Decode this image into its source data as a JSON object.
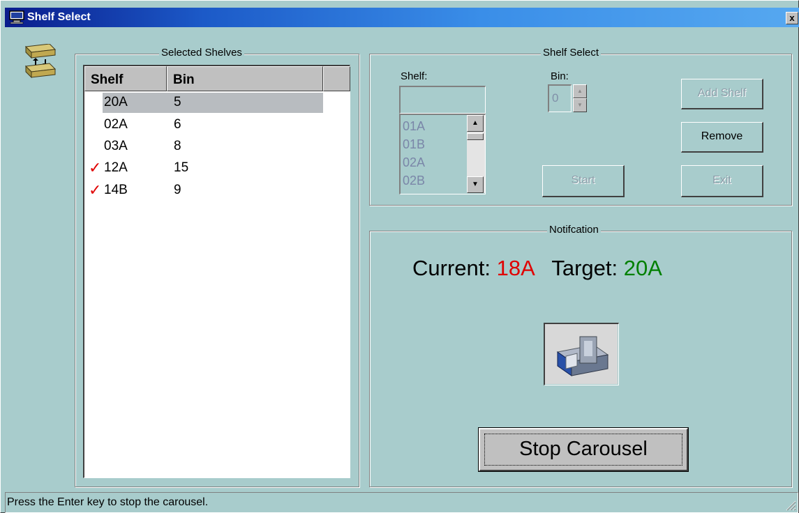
{
  "window": {
    "title": "Shelf Select",
    "close_glyph": "x",
    "title_icon": "window-app-icon"
  },
  "app_icon": "shelf-carousel-icon",
  "selected_shelves": {
    "title": "Selected Shelves",
    "columns": [
      "Shelf",
      "Bin"
    ],
    "rows": [
      {
        "shelf": "20A",
        "bin": "5",
        "checked": false,
        "selected": true
      },
      {
        "shelf": "02A",
        "bin": "6",
        "checked": false,
        "selected": false
      },
      {
        "shelf": "03A",
        "bin": "8",
        "checked": false,
        "selected": false
      },
      {
        "shelf": "12A",
        "bin": "15",
        "checked": true,
        "selected": false
      },
      {
        "shelf": "14B",
        "bin": "9",
        "checked": true,
        "selected": false
      }
    ],
    "check_glyph": "✓"
  },
  "shelf_select": {
    "title": "Shelf Select",
    "shelf_label": "Shelf:",
    "shelf_value": "",
    "shelf_items": [
      "01A",
      "01B",
      "02A",
      "02B"
    ],
    "bin_label": "Bin:",
    "bin_value": "0",
    "add_shelf_label": "Add Shelf",
    "remove_label": "Remove",
    "start_label": "Start",
    "exit_label": "Exit"
  },
  "notification": {
    "title": "Notifcation",
    "current_label": "Current:",
    "current_value": "18A",
    "target_label": "Target:",
    "target_value": "20A",
    "current_color": "#e00000",
    "target_color": "#008000",
    "image": "carousel-machine-image"
  },
  "stop_button_label": "Stop Carousel",
  "status_text": "Press the Enter key to stop the carousel."
}
